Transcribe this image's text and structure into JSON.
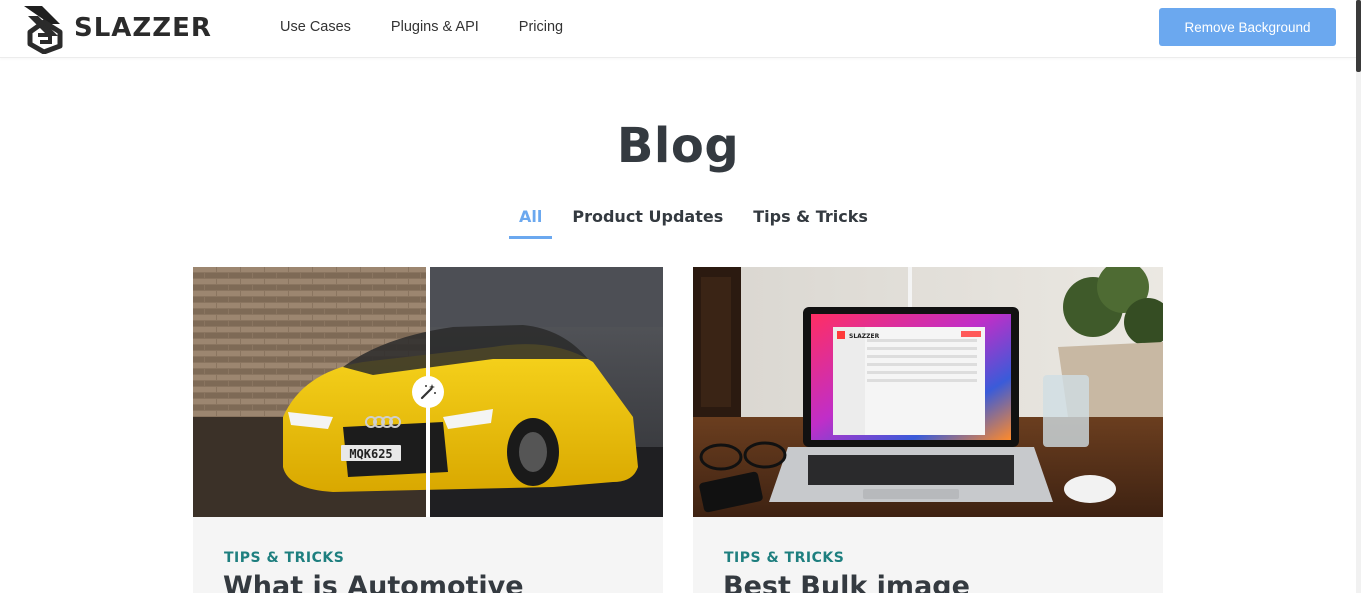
{
  "brand": {
    "name": "SLAZZER"
  },
  "nav": [
    {
      "label": "Use Cases"
    },
    {
      "label": "Plugins & API"
    },
    {
      "label": "Pricing"
    }
  ],
  "cta": {
    "label": "Remove Background"
  },
  "page": {
    "title": "Blog"
  },
  "tabs": [
    {
      "label": "All",
      "active": true
    },
    {
      "label": "Product Updates",
      "active": false
    },
    {
      "label": "Tips & Tricks",
      "active": false
    }
  ],
  "cards": [
    {
      "category": "TIPS & TRICKS",
      "title": "What is Automotive",
      "plate": "MQK625"
    },
    {
      "category": "TIPS & TRICKS",
      "title": "Best Bulk image",
      "screen_brand": "SLAZZER"
    }
  ],
  "colors": {
    "accent": "#6ba8ef",
    "category": "#1e7f7f",
    "heading": "#343a40"
  },
  "icons": [
    "slazzer-logo-icon",
    "magic-wand-icon"
  ]
}
